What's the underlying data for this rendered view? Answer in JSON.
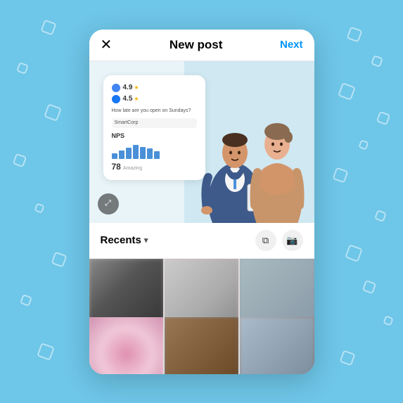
{
  "header": {
    "close_icon": "✕",
    "title": "New post",
    "next_label": "Next"
  },
  "ratings": {
    "google_value": "4.9",
    "google_star": "★",
    "fb_value": "4.5",
    "fb_star": "★"
  },
  "question": {
    "text": "How late are you open on Sundays?"
  },
  "input_placeholder": "SmartCorp",
  "nps": {
    "label": "NPS",
    "score": "78",
    "score_sublabel": "Amazing"
  },
  "recents": {
    "label": "Recents",
    "chevron": "▾"
  },
  "bars": [
    30,
    50,
    65,
    80,
    70,
    60,
    45
  ],
  "icons": {
    "expand": "⤢",
    "copy": "⧉",
    "camera": "⊙"
  }
}
